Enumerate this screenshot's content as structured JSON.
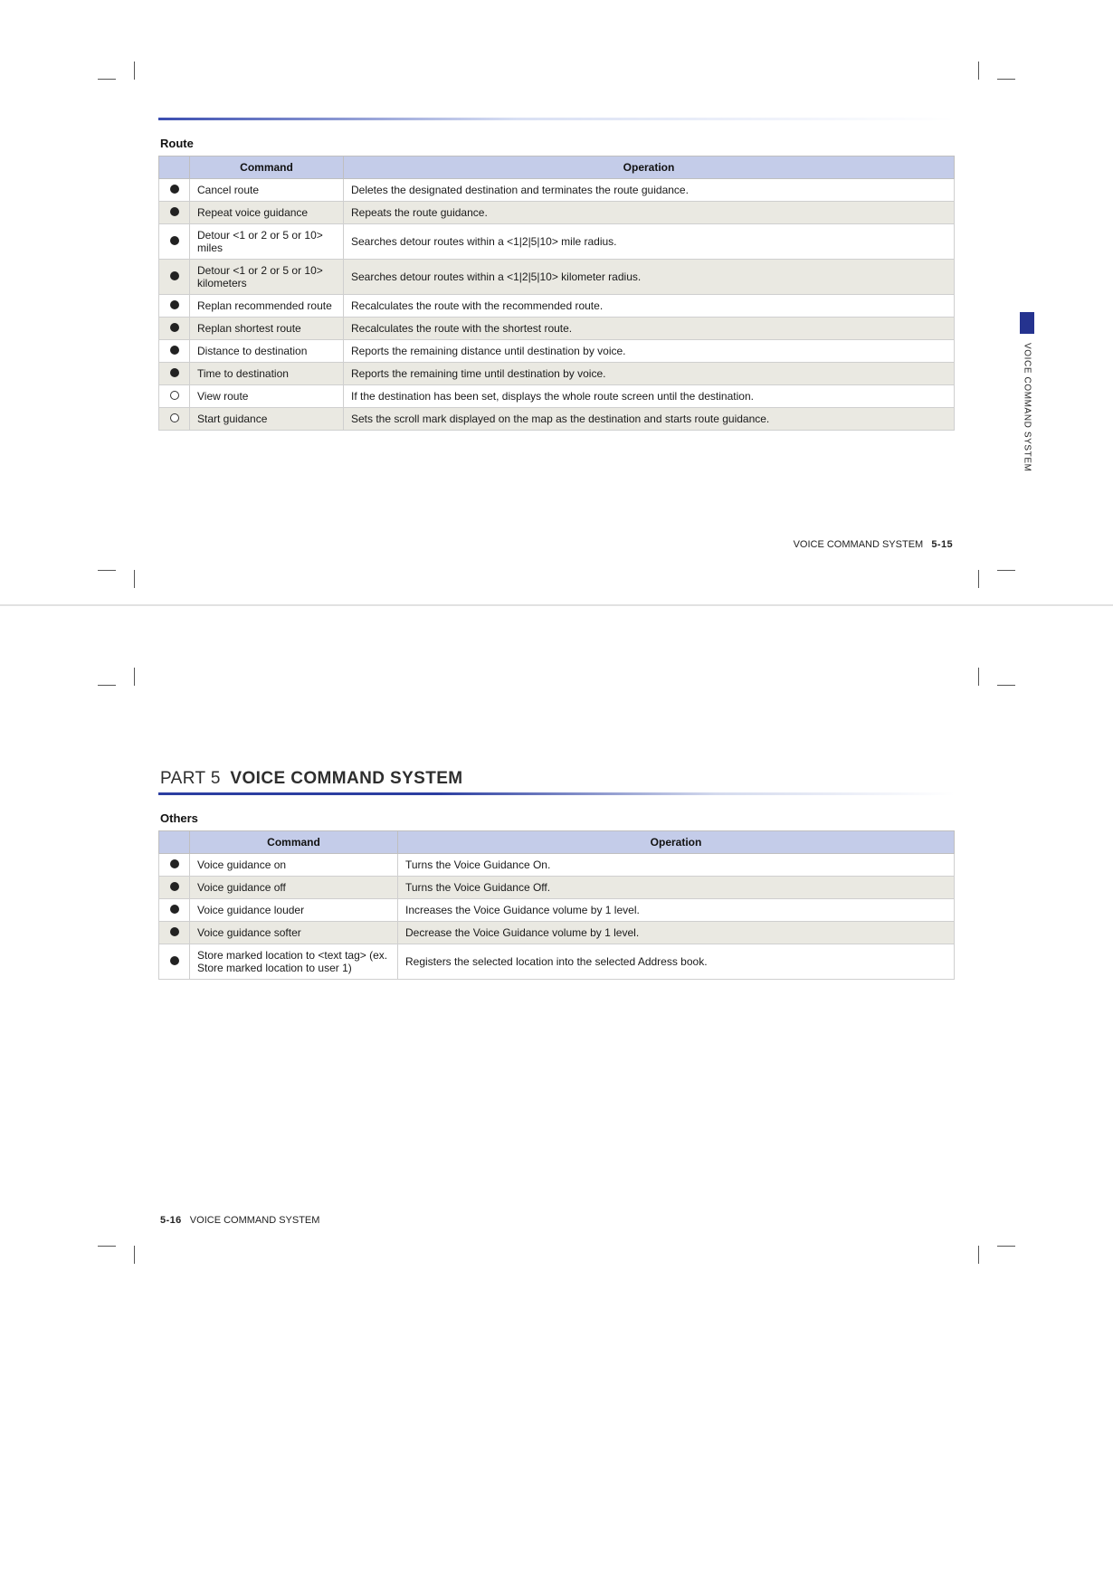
{
  "page1": {
    "section_title": "Route",
    "thead": {
      "bullet": "",
      "command": "Command",
      "operation": "Operation"
    },
    "rows": [
      {
        "bullet": "filled",
        "command": "Cancel route",
        "operation": "Deletes the designated destination and terminates the route guidance."
      },
      {
        "bullet": "filled",
        "command": "Repeat voice guidance",
        "operation": "Repeats the route guidance."
      },
      {
        "bullet": "filled",
        "command": "Detour <1 or 2 or 5 or 10> miles",
        "operation": "Searches detour routes within a <1|2|5|10> mile radius."
      },
      {
        "bullet": "filled",
        "command": "Detour <1 or 2 or 5 or 10> kilometers",
        "operation": "Searches detour routes within a <1|2|5|10> kilometer radius."
      },
      {
        "bullet": "filled",
        "command": "Replan recommended route",
        "operation": "Recalculates the route with the recommended route."
      },
      {
        "bullet": "filled",
        "command": "Replan shortest route",
        "operation": "Recalculates the route with the shortest route."
      },
      {
        "bullet": "filled",
        "command": "Distance to destination",
        "operation": "Reports the remaining distance until destination by voice."
      },
      {
        "bullet": "filled",
        "command": "Time to destination",
        "operation": "Reports the remaining time until destination by voice."
      },
      {
        "bullet": "hollow",
        "command": "View route",
        "operation": "If the destination has been set, displays the whole route screen until the destination."
      },
      {
        "bullet": "hollow",
        "command": "Start guidance",
        "operation": "Sets the scroll mark displayed on the map as the destination and starts route guidance."
      }
    ],
    "side_tab": "VOICE COMMAND SYSTEM",
    "footer_label": "VOICE COMMAND SYSTEM",
    "footer_page": "5-15"
  },
  "page2": {
    "part_prefix": "PART 5",
    "part_title": "VOICE COMMAND SYSTEM",
    "section_title": "Others",
    "thead": {
      "bullet": "",
      "command": "Command",
      "operation": "Operation"
    },
    "rows": [
      {
        "bullet": "filled",
        "command": "Voice guidance on",
        "operation": "Turns the Voice Guidance On."
      },
      {
        "bullet": "filled",
        "command": "Voice guidance off",
        "operation": "Turns the Voice Guidance Off."
      },
      {
        "bullet": "filled",
        "command": "Voice guidance louder",
        "operation": "Increases the Voice Guidance volume by 1 level."
      },
      {
        "bullet": "filled",
        "command": "Voice guidance softer",
        "operation": "Decrease the Voice Guidance volume by 1 level."
      },
      {
        "bullet": "filled",
        "command": "Store marked location to <text tag> (ex. Store marked location to user 1)",
        "operation": "Registers the selected location into the selected Address book."
      }
    ],
    "footer_page": "5-16",
    "footer_label": "VOICE COMMAND SYSTEM"
  }
}
